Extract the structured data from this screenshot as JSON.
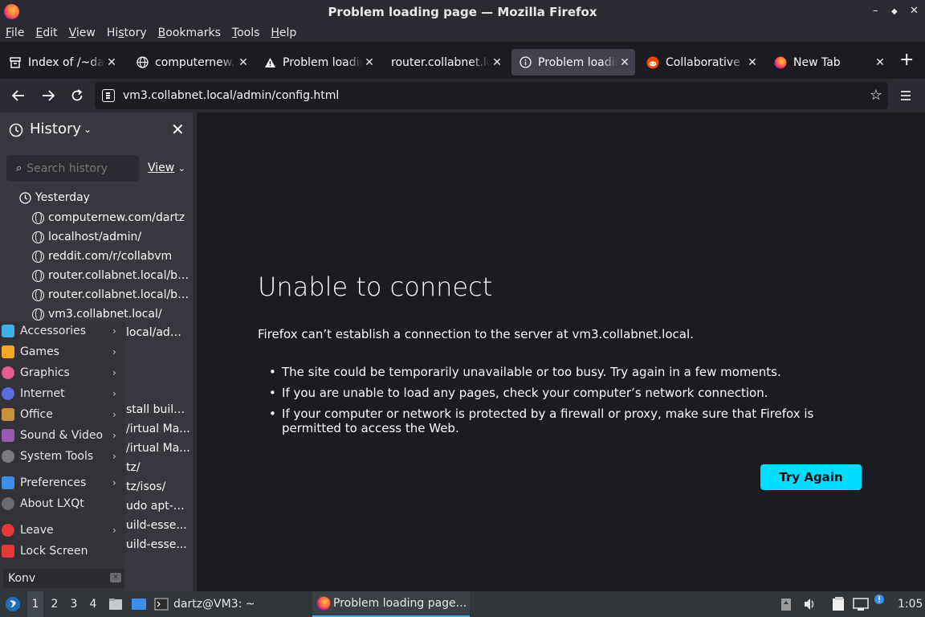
{
  "window": {
    "title": "Problem loading page — Mozilla Firefox",
    "controls": [
      "–",
      "◆",
      "✕"
    ]
  },
  "menubar": {
    "items": [
      {
        "label": "File",
        "u": "F",
        "rest": "ile"
      },
      {
        "label": "Edit",
        "u": "E",
        "rest": "dit"
      },
      {
        "label": "View",
        "u": "V",
        "rest": "iew"
      },
      {
        "label": "History",
        "u": "S",
        "pre": "Hi",
        "rest": "tory"
      },
      {
        "label": "Bookmarks",
        "u": "B",
        "rest": "ookmarks"
      },
      {
        "label": "Tools",
        "u": "T",
        "rest": "ools"
      },
      {
        "label": "Help",
        "u": "H",
        "rest": "elp"
      }
    ]
  },
  "tabs": [
    {
      "label": "Index of /~dartz/",
      "icon": "archive-icon",
      "active": false
    },
    {
      "label": "computernew.com/dartz",
      "icon": "globe-icon",
      "active": false
    },
    {
      "label": "Problem loading page",
      "icon": "warning-icon",
      "active": false
    },
    {
      "label": "router.collabnet.local",
      "icon": "none",
      "active": false
    },
    {
      "label": "Problem loading page",
      "icon": "info-icon",
      "active": true
    },
    {
      "label": "Collaborative VMs",
      "icon": "reddit-icon",
      "active": false
    },
    {
      "label": "New Tab",
      "icon": "firefox-icon",
      "active": false
    }
  ],
  "navbar": {
    "url": "vm3.collabnet.local/admin/config.html"
  },
  "sidebar": {
    "title": "History",
    "search_placeholder": "Search history",
    "view_label": "View",
    "group": "Yesterday",
    "items": [
      "computernew.com/dartz",
      "localhost/admin/",
      "reddit.com/r/collabvm",
      "router.collabnet.local/bl...",
      "router.collabnet.local/bl...",
      "vm3.collabnet.local/"
    ],
    "fragments": [
      "local/adm...",
      "stall build...",
      "/irtual Ma...",
      "/irtual Ma...",
      "tz/",
      "tz/isos/",
      "udo apt-g...",
      "uild-esse...",
      "uild-esse..."
    ]
  },
  "start_menu": {
    "items": [
      {
        "label": "Accessories",
        "icon": "accessories-icon",
        "color": "#3daee9",
        "arrow": true
      },
      {
        "label": "Games",
        "icon": "games-icon",
        "color": "#f5a623",
        "arrow": true
      },
      {
        "label": "Graphics",
        "icon": "graphics-icon",
        "color": "#e05d8c",
        "arrow": true
      },
      {
        "label": "Internet",
        "icon": "internet-icon",
        "color": "#5b6be0",
        "arrow": true
      },
      {
        "label": "Office",
        "icon": "office-icon",
        "color": "#c8923a",
        "arrow": true
      },
      {
        "label": "Sound & Video",
        "icon": "sound-video-icon",
        "color": "#9b59b6",
        "arrow": true
      },
      {
        "label": "System Tools",
        "icon": "system-tools-icon",
        "color": "#7a7a80",
        "arrow": true
      },
      {
        "label": "Preferences",
        "icon": "preferences-icon",
        "color": "#3d8ee9",
        "arrow": true
      },
      {
        "label": "About LXQt",
        "icon": "about-icon",
        "color": "#6a6a70",
        "arrow": false
      },
      {
        "label": "Leave",
        "icon": "power-icon",
        "color": "#e53935",
        "arrow": true
      },
      {
        "label": "Lock Screen",
        "icon": "lock-icon",
        "color": "#e53935",
        "arrow": false
      }
    ],
    "search_value": "Konv"
  },
  "content": {
    "title": "Unable to connect",
    "description": "Firefox can’t establish a connection to the server at vm3.collabnet.local.",
    "bullets": [
      "The site could be temporarily unavailable or too busy. Try again in a few moments.",
      "If you are unable to load any pages, check your computer’s network connection.",
      "If your computer or network is protected by a firewall or proxy, make sure that Firefox is permitted to access the Web."
    ],
    "button": "Try Again"
  },
  "taskbar": {
    "desktops": [
      "1",
      "2",
      "3",
      "4"
    ],
    "tasks": [
      {
        "label": "dartz@VM3: ~",
        "icon": "terminal-icon",
        "active": false
      },
      {
        "label": "Problem loading page...",
        "icon": "firefox-icon",
        "active": true
      }
    ],
    "clock": "1:05"
  },
  "colors": {
    "accent": "#00ddff",
    "page_bg": "#1c1b22",
    "sidebar_bg": "#38373f",
    "taskbar_bg": "#31363b"
  }
}
